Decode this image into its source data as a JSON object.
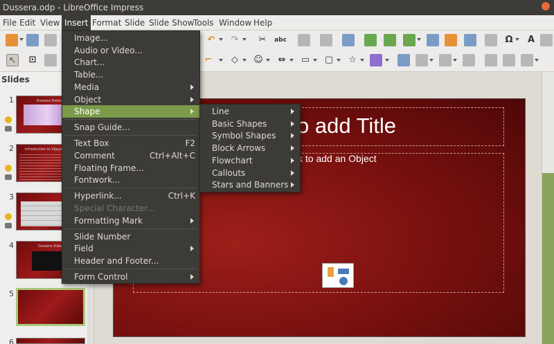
{
  "window": {
    "title": "Dussera.odp - LibreOffice Impress"
  },
  "menubar": {
    "items": [
      "File",
      "Edit",
      "View",
      "Insert",
      "Format",
      "Slide",
      "Slide Show",
      "Tools",
      "Window",
      "Help"
    ],
    "active": "Insert"
  },
  "slides_panel": {
    "title": "Slides",
    "slides": [
      {
        "number": "1",
        "caption": "Dussera Festival"
      },
      {
        "number": "2",
        "caption": "Introduction to Vijaya Dasami"
      },
      {
        "number": "3",
        "caption": ""
      },
      {
        "number": "4",
        "caption": "Dussera Video"
      },
      {
        "number": "5",
        "caption": ""
      },
      {
        "number": "6",
        "caption": ""
      }
    ],
    "selected": "5"
  },
  "slide": {
    "title_placeholder": "Click to add Title",
    "title_visible": "o add Title",
    "object_placeholder_visible": "ck to add an Object"
  },
  "insert_menu": {
    "items": [
      {
        "label": "Image...",
        "shortcut": "",
        "submenu": false,
        "disabled": false
      },
      {
        "label": "Audio or Video...",
        "shortcut": "",
        "submenu": false,
        "disabled": false
      },
      {
        "label": "Chart...",
        "shortcut": "",
        "submenu": false,
        "disabled": false
      },
      {
        "label": "Table...",
        "shortcut": "",
        "submenu": false,
        "disabled": false
      },
      {
        "label": "Media",
        "shortcut": "",
        "submenu": true,
        "disabled": false
      },
      {
        "label": "Object",
        "shortcut": "",
        "submenu": true,
        "disabled": false
      },
      {
        "label": "Shape",
        "shortcut": "",
        "submenu": true,
        "disabled": false,
        "highlighted": true
      },
      {
        "label": "Snap Guide...",
        "shortcut": "",
        "submenu": false,
        "disabled": false
      },
      {
        "label": "Text Box",
        "shortcut": "F2",
        "submenu": false,
        "disabled": false
      },
      {
        "label": "Comment",
        "shortcut": "Ctrl+Alt+C",
        "submenu": false,
        "disabled": false
      },
      {
        "label": "Floating Frame...",
        "shortcut": "",
        "submenu": false,
        "disabled": false
      },
      {
        "label": "Fontwork...",
        "shortcut": "",
        "submenu": false,
        "disabled": false
      },
      {
        "label": "Hyperlink...",
        "shortcut": "Ctrl+K",
        "submenu": false,
        "disabled": false
      },
      {
        "label": "Special Character...",
        "shortcut": "",
        "submenu": false,
        "disabled": true
      },
      {
        "label": "Formatting Mark",
        "shortcut": "",
        "submenu": true,
        "disabled": false
      },
      {
        "label": "Slide Number",
        "shortcut": "",
        "submenu": false,
        "disabled": false
      },
      {
        "label": "Field",
        "shortcut": "",
        "submenu": true,
        "disabled": false
      },
      {
        "label": "Header and Footer...",
        "shortcut": "",
        "submenu": false,
        "disabled": false
      },
      {
        "label": "Form Control",
        "shortcut": "",
        "submenu": true,
        "disabled": false
      }
    ]
  },
  "shape_submenu": {
    "items": [
      "Line",
      "Basic Shapes",
      "Symbol Shapes",
      "Block Arrows",
      "Flowchart",
      "Callouts",
      "Stars and Banners"
    ]
  },
  "colors": {
    "menu_bg": "#3c3b37",
    "menu_highlight": "#7b9a4a",
    "slide_red": "#7c1210"
  },
  "icons": [
    "new-icon",
    "open-icon",
    "save-icon",
    "undo-icon",
    "redo-icon",
    "spellcheck-icon",
    "grid-icon",
    "table-icon",
    "image-icon",
    "media-icon",
    "chart-icon",
    "textbox-icon",
    "special-char-icon",
    "fontwork-icon",
    "select-icon",
    "line-icon",
    "shape-icon",
    "smiley-icon",
    "arrow-icon",
    "3d-icon"
  ]
}
